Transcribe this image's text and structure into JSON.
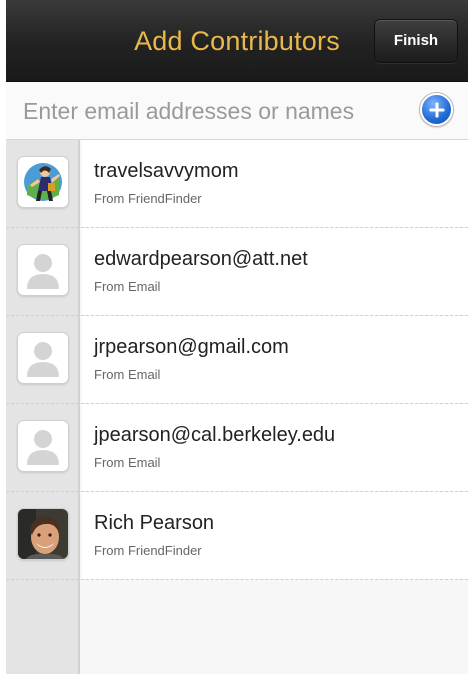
{
  "header": {
    "title": "Add Contributors",
    "finish_label": "Finish"
  },
  "search": {
    "placeholder": "Enter email addresses or names",
    "value": ""
  },
  "colors": {
    "title_text": "#e9b84a",
    "add_button": "#1f6ad6",
    "navbar": "#222222"
  },
  "contacts": [
    {
      "name": "travelsavvymom",
      "source": "From FriendFinder",
      "avatar": "cartoon-photo-icon"
    },
    {
      "name": "edwardpearson@att.net",
      "source": "From Email",
      "avatar": "person-placeholder-icon"
    },
    {
      "name": "jrpearson@gmail.com",
      "source": "From Email",
      "avatar": "person-placeholder-icon"
    },
    {
      "name": "jpearson@cal.berkeley.edu",
      "source": "From Email",
      "avatar": "person-placeholder-icon"
    },
    {
      "name": "Rich  Pearson",
      "source": "From FriendFinder",
      "avatar": "profile-photo-icon"
    }
  ]
}
